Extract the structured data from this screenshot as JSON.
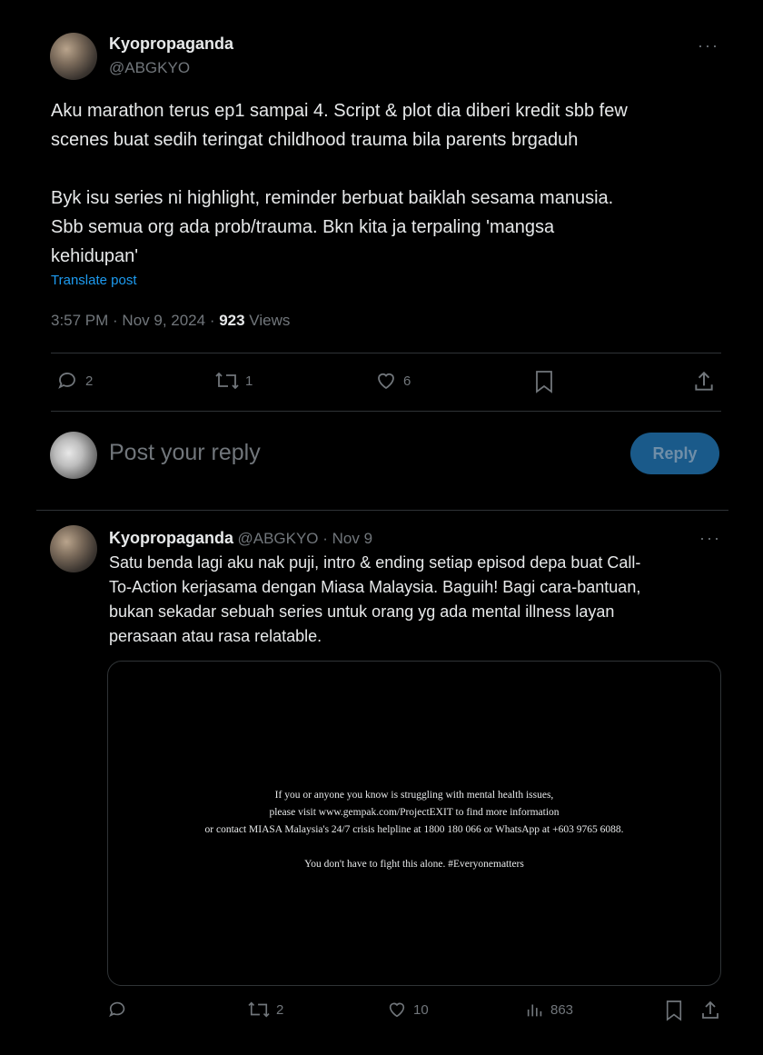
{
  "main_post": {
    "author_name": "Kyopropaganda",
    "author_handle": "@ABGKYO",
    "more_icon": "more-horizontal-icon",
    "text": "Aku marathon terus ep1 sampai 4. Script & plot dia diberi kredit sbb few\nscenes buat sedih teringat childhood trauma bila parents brgaduh\n\nByk isu series ni highlight, reminder berbuat baiklah sesama manusia.\nSbb semua org ada prob/trauma. Bkn kita ja terpaling 'mangsa\nkehidupan'",
    "translate_label": "Translate post",
    "timestamp": "3:57 PM · Nov 9, 2024 · ",
    "views_count": "923",
    "views_label": " Views",
    "actions": {
      "reply_count": "2",
      "repost_count": "1",
      "like_count": "6"
    }
  },
  "reply_composer": {
    "placeholder": "Post your reply",
    "button_label": "Reply"
  },
  "reply_post": {
    "author_name": "Kyopropaganda",
    "author_handle": "@ABGKYO",
    "date": " · Nov 9",
    "text": "Satu benda lagi aku nak puji, intro & ending setiap episod depa buat Call-\nTo-Action kerjasama dengan Miasa Malaysia. Baguih! Bagi cara-bantuan,\nbukan sekadar sebuah series untuk orang yg ada mental illness layan\nperasaan atau rasa relatable.",
    "media_text": "If you or anyone you know is struggling with mental health issues,\nplease visit www.gempak.com/ProjectEXIT to find more information\nor contact MIASA Malaysia's 24/7 crisis helpline at 1800 180 066 or WhatsApp at +603 9765 6088.\n\nYou don't have to fight this alone. #Everyonematters",
    "actions": {
      "reply_count": "",
      "repost_count": "2",
      "like_count": "10",
      "views_count": "863"
    }
  },
  "colors": {
    "background": "#000000",
    "text": "#e7e9ea",
    "muted": "#71767b",
    "link": "#1d9bf0",
    "divider": "#2f3336",
    "reply_button_bg": "#1a5a8a"
  }
}
